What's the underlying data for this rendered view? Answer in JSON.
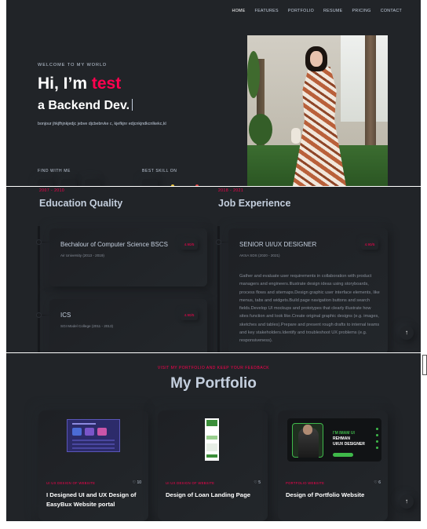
{
  "nav": [
    "HOME",
    "FEATURES",
    "PORTFOLIO",
    "RESUME",
    "PRICING",
    "CONTACT"
  ],
  "hero": {
    "welcome": "WELCOME TO MY WORLD",
    "greeting": "Hi, I’m ",
    "name": "test",
    "role": "a Backend Dev.",
    "bio": "bonjour jhkjfhjnkjedjc jebve djcbebrvke c, kjefkjnr edjcnkjndkcnlkekc,kl",
    "find_label": "FIND WITH ME",
    "skill_label": "BEST SKILL ON"
  },
  "colors": {
    "accent": "#ff014f",
    "background": "#212428",
    "text": "#c4cfde",
    "muted": "#878e99"
  },
  "resume": {
    "education": {
      "years": "2007 - 2010",
      "title": "Education Quality",
      "items": [
        {
          "title": "Bechalour of Computer Science BSCS",
          "subtitle": "Air University (2013 - 2019)",
          "grade": "4.90/5"
        },
        {
          "title": "ICS",
          "subtitle": "SGI Model College (2011 - 2013)",
          "grade": "4.90/5"
        }
      ]
    },
    "experience": {
      "years": "2018 - 2021",
      "title": "Job Experience",
      "items": [
        {
          "title": "SENIOR UI/UX DESIGNER",
          "subtitle": "AKSA SDS (2020 - 2021)",
          "grade": "4.90/5",
          "description": "Gather and evaluate user requirements in collaboration with product managers and engineers.Illustrate design ideas using storyboards, process flows and sitemaps.Design graphic user interface elements, like menus, tabs and widgets.Build page navigation buttons and search fields.Develop UI mockups and prototypes that clearly illustrate how sites function and look like.Create original graphic designs (e.g. images, sketches and tables).Prepare and present rough drafts to internal teams and key stakeholders.Identify and troubleshoot UX problems (e.g. responsiveness)."
        }
      ]
    }
  },
  "portfolio": {
    "eyebrow": "VISIT MY PORTFOLIO AND KEEP YOUR FEEDBACK",
    "title": "My Portfolio",
    "items": [
      {
        "category": "UI UX DESIGN OF WEBSITE",
        "likes": "10",
        "title": "I Designed UI and UX Design of EasyBux Website portal"
      },
      {
        "category": "UI UX DESIGN OF WEBSITE",
        "likes": "5",
        "title": "Design of Loan Landing Page"
      },
      {
        "category": "PORTFOLIO WEBSITE",
        "likes": "6",
        "title": "Design of Portfolio Website"
      }
    ],
    "thumb3": {
      "line1": "I'M IMAM UI",
      "line2": "REHMAN",
      "line3": "UI/UX DESIGNER"
    }
  },
  "icons": {
    "scroll_top": "arrow-up-icon",
    "like": "heart-icon"
  },
  "glyphs": {
    "up": "↑",
    "heart": "♡"
  }
}
